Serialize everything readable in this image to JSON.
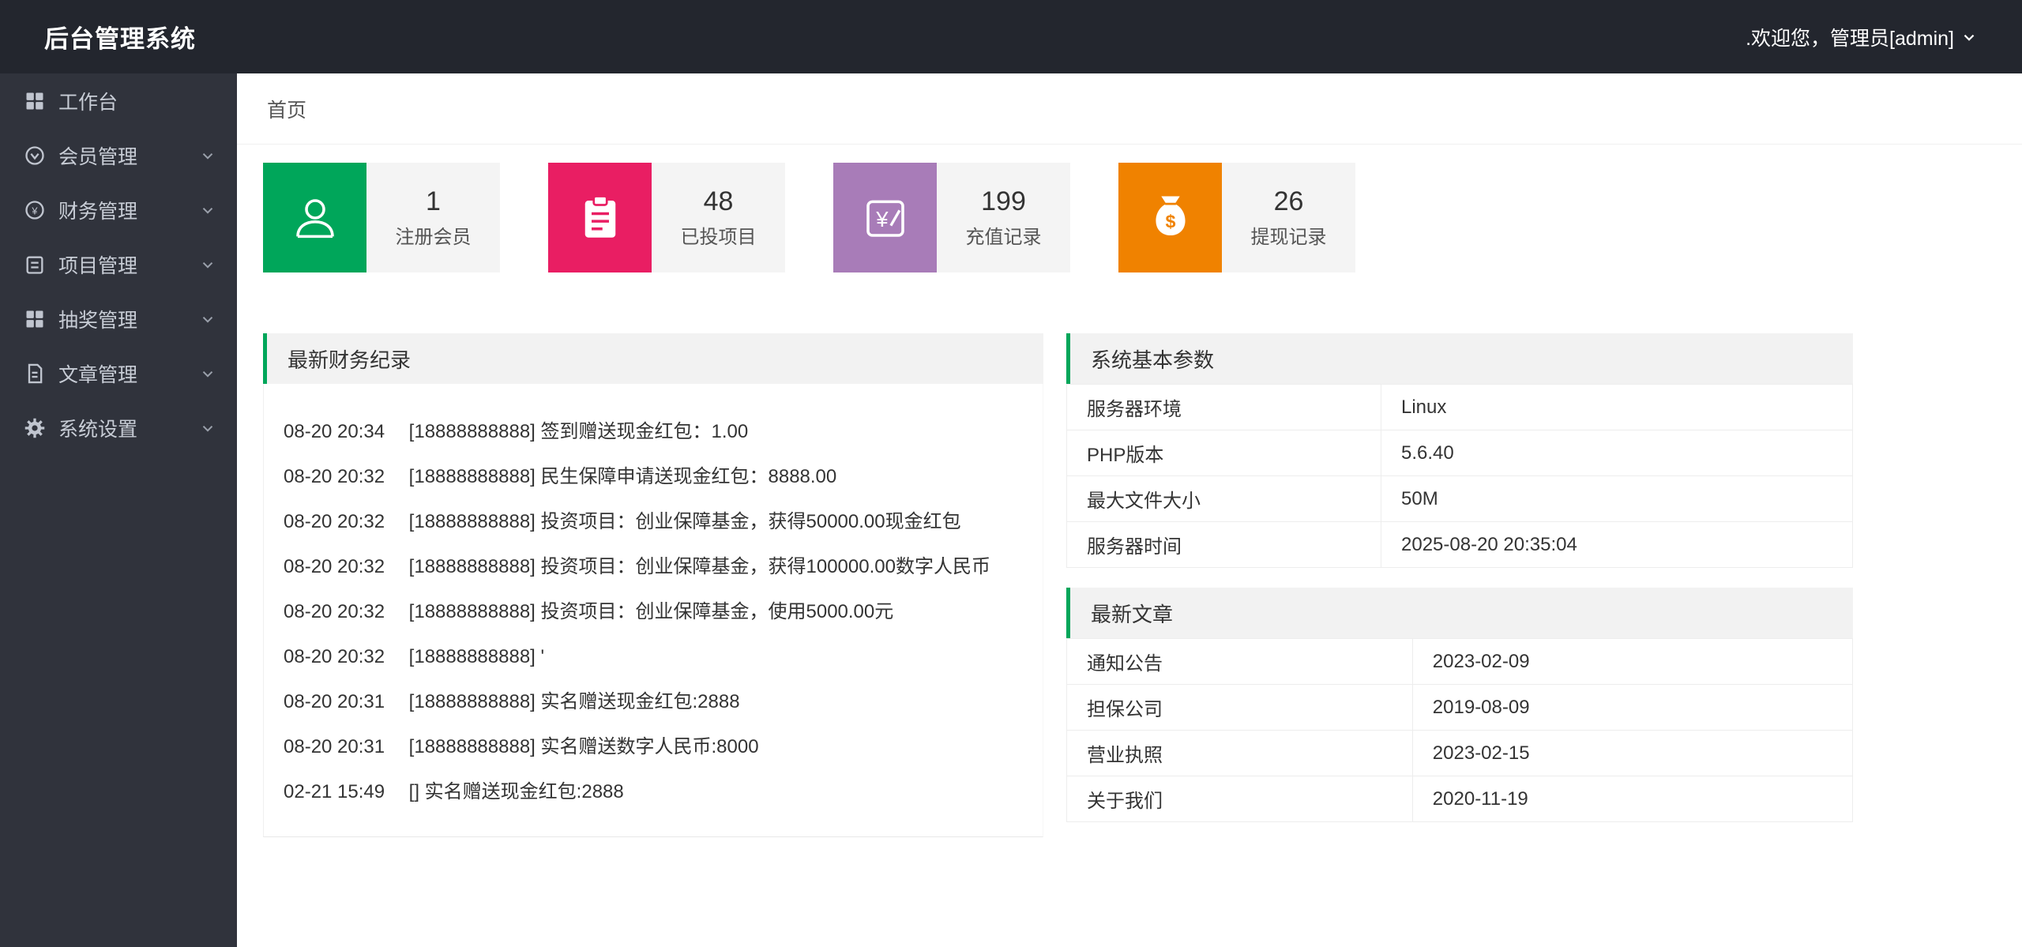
{
  "theme": {
    "topbar_bg": "#23262E",
    "sidebar_bg": "#30333C",
    "accent_green": "#00A65A"
  },
  "header": {
    "title": "后台管理系统",
    "welcome": ".欢迎您，管理员[admin]"
  },
  "sidebar": {
    "items": [
      {
        "label": "工作台",
        "icon": "grid-icon",
        "expandable": false
      },
      {
        "label": "会员管理",
        "icon": "member-icon",
        "expandable": true
      },
      {
        "label": "财务管理",
        "icon": "finance-icon",
        "expandable": true
      },
      {
        "label": "项目管理",
        "icon": "project-icon",
        "expandable": true
      },
      {
        "label": "抽奖管理",
        "icon": "lottery-icon",
        "expandable": true
      },
      {
        "label": "文章管理",
        "icon": "article-icon",
        "expandable": true
      },
      {
        "label": "系统设置",
        "icon": "gear-icon",
        "expandable": true
      }
    ]
  },
  "breadcrumb": {
    "label": "首页"
  },
  "stats": [
    {
      "icon": "user-icon",
      "color": "#00A65A",
      "value": "1",
      "label": "注册会员"
    },
    {
      "icon": "clipboard-icon",
      "color": "#E91E63",
      "value": "48",
      "label": "已投项目"
    },
    {
      "icon": "recharge-icon",
      "color": "#A87CB8",
      "value": "199",
      "label": "充值记录"
    },
    {
      "icon": "moneybag-icon",
      "color": "#F08200",
      "value": "26",
      "label": "提现记录"
    }
  ],
  "finance_panel": {
    "title": "最新财务纪录",
    "records": [
      {
        "time": "08-20 20:34",
        "text": "[18888888888] 签到赠送现金红包：1.00"
      },
      {
        "time": "08-20 20:32",
        "text": "[18888888888] 民生保障申请送现金红包：8888.00"
      },
      {
        "time": "08-20 20:32",
        "text": "[18888888888] 投资项目：创业保障基金，获得50000.00现金红包"
      },
      {
        "time": "08-20 20:32",
        "text": "[18888888888] 投资项目：创业保障基金，获得100000.00数字人民币"
      },
      {
        "time": "08-20 20:32",
        "text": "[18888888888] 投资项目：创业保障基金，使用5000.00元"
      },
      {
        "time": "08-20 20:32",
        "text": "[18888888888] '"
      },
      {
        "time": "08-20 20:31",
        "text": "[18888888888] 实名赠送现金红包:2888"
      },
      {
        "time": "08-20 20:31",
        "text": "[18888888888] 实名赠送数字人民币:8000"
      },
      {
        "time": "02-21 15:49",
        "text": "[] 实名赠送现金红包:2888"
      }
    ]
  },
  "system_panel": {
    "title": "系统基本参数",
    "rows": [
      {
        "key": "服务器环境",
        "value": "Linux"
      },
      {
        "key": "PHP版本",
        "value": "5.6.40"
      },
      {
        "key": "最大文件大小",
        "value": "50M"
      },
      {
        "key": "服务器时间",
        "value": "2025-08-20 20:35:04"
      }
    ]
  },
  "article_panel": {
    "title": "最新文章",
    "rows": [
      {
        "key": "通知公告",
        "value": "2023-02-09"
      },
      {
        "key": "担保公司",
        "value": "2019-08-09"
      },
      {
        "key": "营业执照",
        "value": "2023-02-15"
      },
      {
        "key": "关于我们",
        "value": "2020-11-19"
      }
    ]
  }
}
